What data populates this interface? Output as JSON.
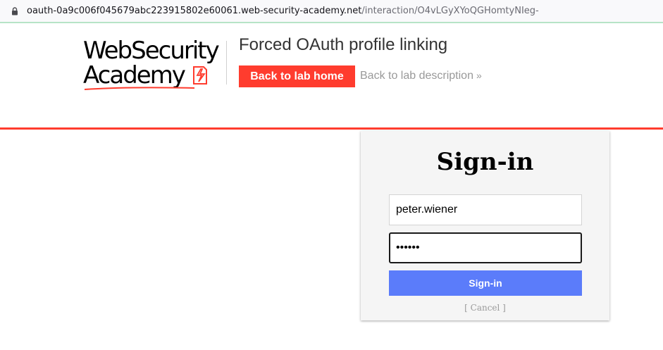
{
  "browser": {
    "url_host": "oauth-0a9c006f045679abc223915802e60061.web-security-academy.net",
    "url_path": "/interaction/O4vLGyXYoQGHomtyNIeg-"
  },
  "header": {
    "logo_text": "WebSecurity\nAcademy",
    "lab_title": "Forced OAuth profile linking",
    "back_home_label": "Back to lab home",
    "back_description_label": "Back to lab description",
    "back_description_chevron": "»"
  },
  "signin": {
    "title": "Sign-in",
    "username_value": "peter.wiener",
    "password_value": "••••••",
    "button_label": "Sign-in",
    "cancel_label": "[ Cancel ]"
  },
  "colors": {
    "accent_red": "#ff3c2e",
    "signin_blue": "#5b7cfa",
    "url_green_border": "#b7e4c7"
  }
}
